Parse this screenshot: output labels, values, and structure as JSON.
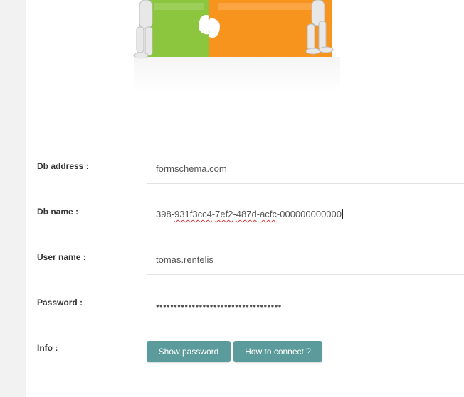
{
  "form": {
    "db_address": {
      "label": "Db address :",
      "value": "formschema.com"
    },
    "db_name": {
      "label": "Db name :",
      "value_parts": [
        "398-",
        "931f3cc4",
        "-",
        "7ef2",
        "-",
        "487d",
        "-",
        "acfc",
        "-000000000000"
      ]
    },
    "user_name": {
      "label": "User name :",
      "value": "tomas.rentelis"
    },
    "password": {
      "label": "Password :",
      "masked": "•••••••••••••••••••••••••••••••••••"
    },
    "info": {
      "label": "Info :"
    }
  },
  "buttons": {
    "show_password": "Show password",
    "how_to_connect": "How to connect ?"
  },
  "colors": {
    "button_bg": "#5b9b9b",
    "puzzle_green": "#8cc63f",
    "puzzle_orange": "#f7941d"
  },
  "images": {
    "hero": "puzzle-people-icon"
  }
}
